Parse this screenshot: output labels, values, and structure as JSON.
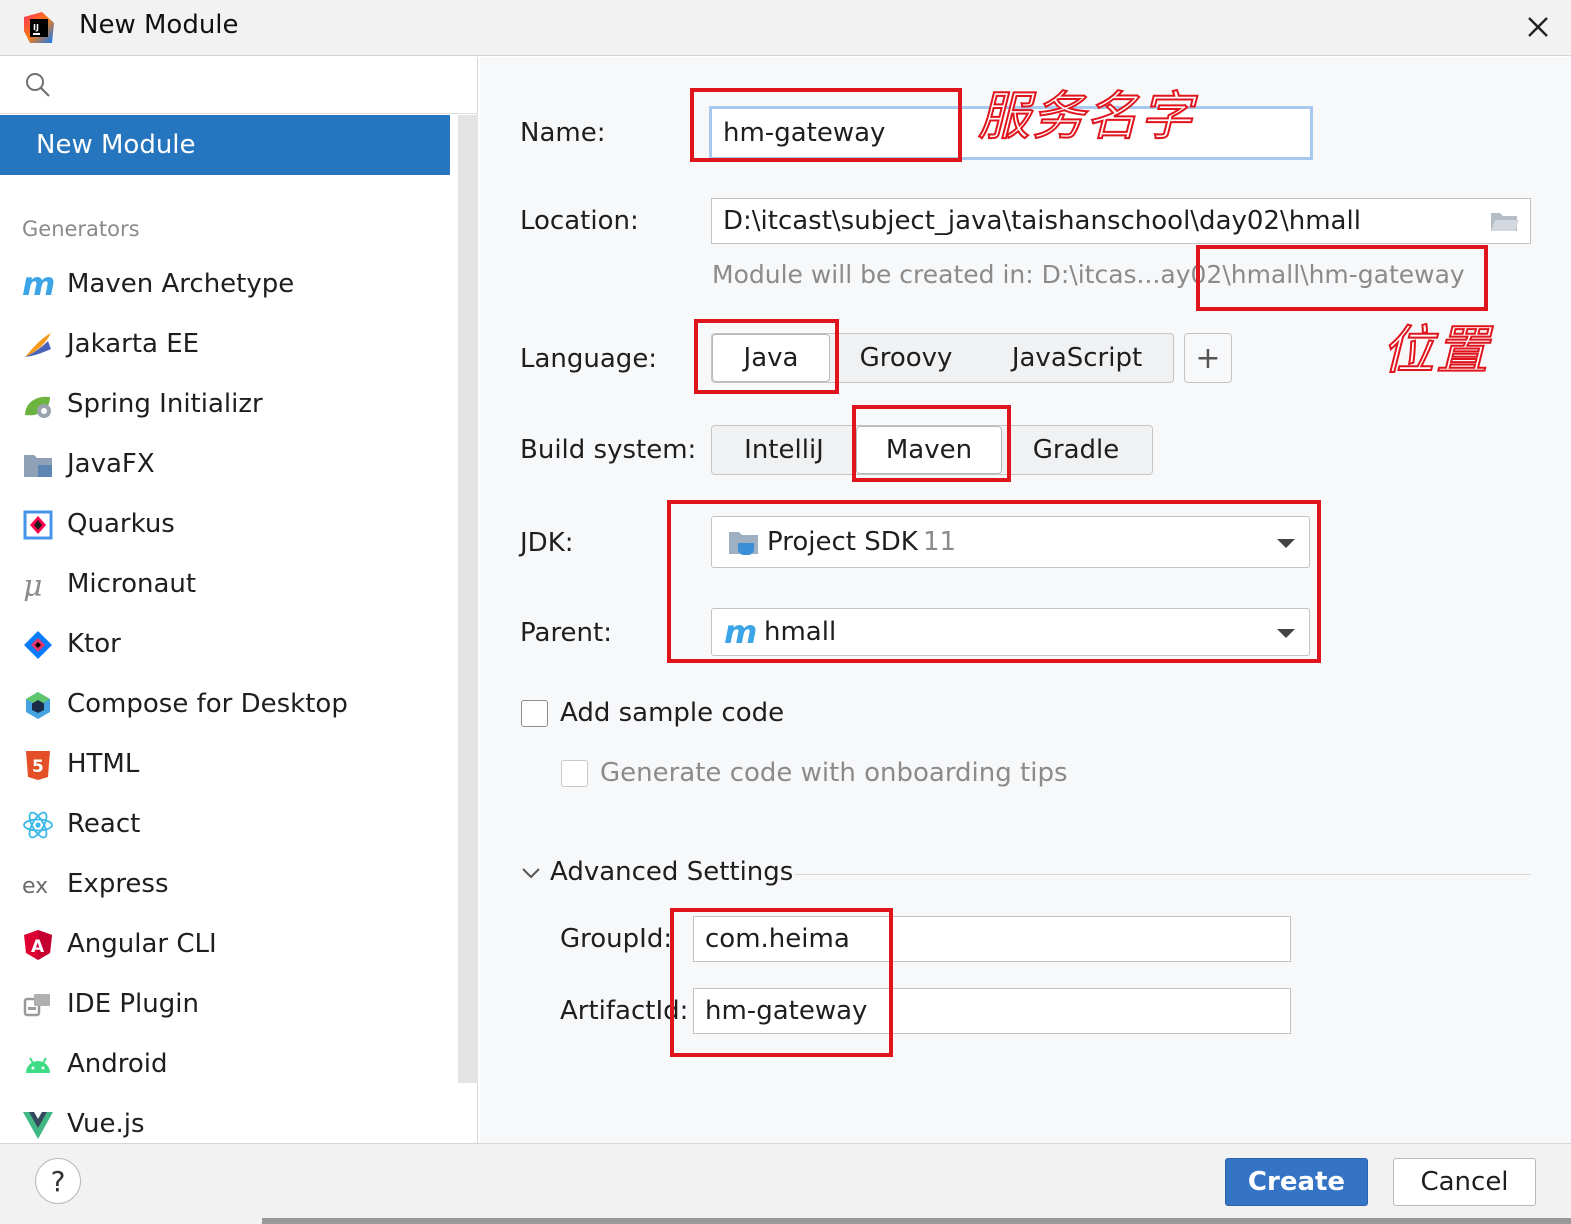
{
  "window": {
    "title": "New Module",
    "app_icon": "intellij-idea-icon",
    "close_icon": "close-icon"
  },
  "sidebar": {
    "search_placeholder": "",
    "selected_item": "New Module",
    "generators_header": "Generators",
    "items": [
      {
        "label": "Maven Archetype",
        "icon": "maven-icon"
      },
      {
        "label": "Jakarta EE",
        "icon": "jakarta-ee-icon"
      },
      {
        "label": "Spring Initializr",
        "icon": "spring-icon"
      },
      {
        "label": "JavaFX",
        "icon": "javafx-folder-icon"
      },
      {
        "label": "Quarkus",
        "icon": "quarkus-icon"
      },
      {
        "label": "Micronaut",
        "icon": "micronaut-icon"
      },
      {
        "label": "Ktor",
        "icon": "ktor-icon"
      },
      {
        "label": "Compose for Desktop",
        "icon": "compose-icon"
      },
      {
        "label": "HTML",
        "icon": "html5-icon"
      },
      {
        "label": "React",
        "icon": "react-icon"
      },
      {
        "label": "Express",
        "icon": "express-icon"
      },
      {
        "label": "Angular CLI",
        "icon": "angular-icon"
      },
      {
        "label": "IDE Plugin",
        "icon": "plugin-icon"
      },
      {
        "label": "Android",
        "icon": "android-icon"
      },
      {
        "label": "Vue.js",
        "icon": "vue-icon"
      }
    ]
  },
  "form": {
    "name_label": "Name:",
    "name_value": "hm-gateway",
    "location_label": "Location:",
    "location_value": "D:\\itcast\\subject_java\\taishanschool\\day02\\hmall",
    "location_hint": "Module will be created in: D:\\itcas...ay02\\hmall\\hm-gateway",
    "language_label": "Language:",
    "languages": [
      "Java",
      "Groovy",
      "JavaScript"
    ],
    "language_selected": "Java",
    "add_language": "+",
    "build_label": "Build system:",
    "build_systems": [
      "IntelliJ",
      "Maven",
      "Gradle"
    ],
    "build_selected": "Maven",
    "jdk_label": "JDK:",
    "jdk_value": "Project SDK",
    "jdk_version": "11",
    "parent_label": "Parent:",
    "parent_value": "hmall",
    "sample_code_label": "Add sample code",
    "onboarding_label": "Generate code with onboarding tips",
    "advanced_label": "Advanced Settings",
    "groupid_label": "GroupId:",
    "groupid_value": "com.heima",
    "artifactid_label": "ArtifactId:",
    "artifactid_value": "hm-gateway"
  },
  "annotations": {
    "service_name": "服务名字",
    "location": "位置"
  },
  "footer": {
    "help": "?",
    "create": "Create",
    "cancel": "Cancel"
  },
  "colors": {
    "accent": "#2675bf",
    "create_button": "#3574c4",
    "annotation_red": "#e0141c"
  }
}
